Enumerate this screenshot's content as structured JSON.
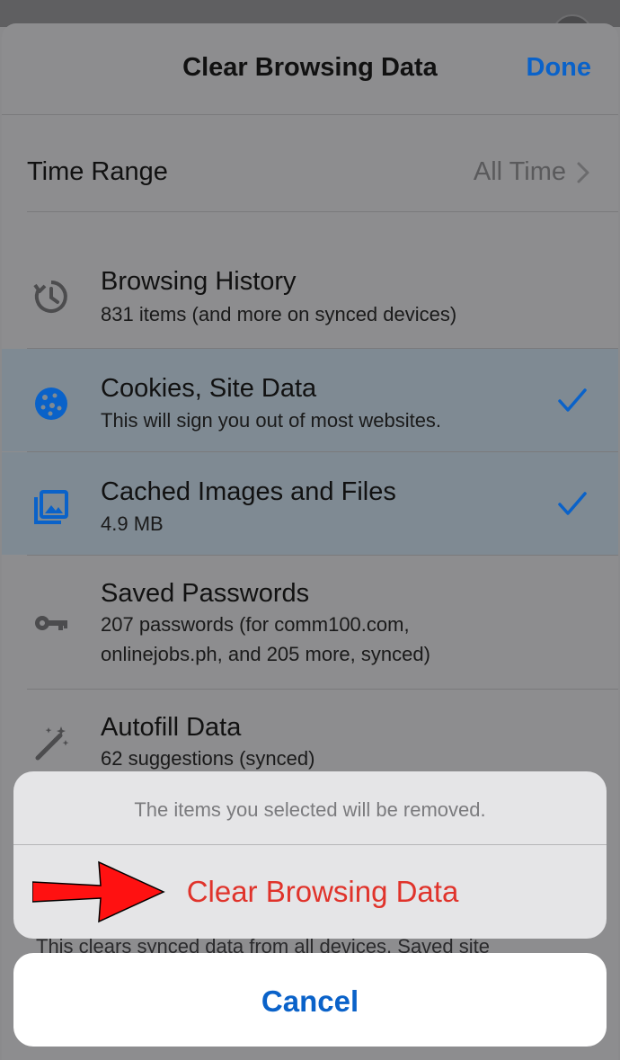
{
  "nav": {
    "title": "Clear Browsing Data",
    "done_label": "Done"
  },
  "time_range": {
    "label": "Time Range",
    "value": "All Time"
  },
  "items": [
    {
      "title": "Browsing History",
      "sub": "831 items (and more on synced devices)",
      "icon": "history-icon",
      "selected": false
    },
    {
      "title": "Cookies, Site Data",
      "sub": "This will sign you out of most websites.",
      "icon": "cookie-icon",
      "selected": true
    },
    {
      "title": "Cached Images and Files",
      "sub": "4.9 MB",
      "icon": "image-icon",
      "selected": true
    },
    {
      "title": "Saved Passwords",
      "sub_line1": "207 passwords (for comm100.com,",
      "sub_line2": "onlinejobs.ph, and 205 more, synced)",
      "icon": "key-icon",
      "selected": false
    },
    {
      "title": "Autofill Data",
      "sub": "62 suggestions (synced)",
      "icon": "magic-wand-icon",
      "selected": false
    }
  ],
  "dialog": {
    "message": "The items you selected will be removed.",
    "clear_label": "Clear Browsing Data"
  },
  "footer_note": "This clears synced data from all devices. Saved site",
  "cancel_label": "Cancel",
  "colors": {
    "accent": "#0a62c9",
    "destructive": "#e0332b",
    "arrow": "#ff1111"
  }
}
